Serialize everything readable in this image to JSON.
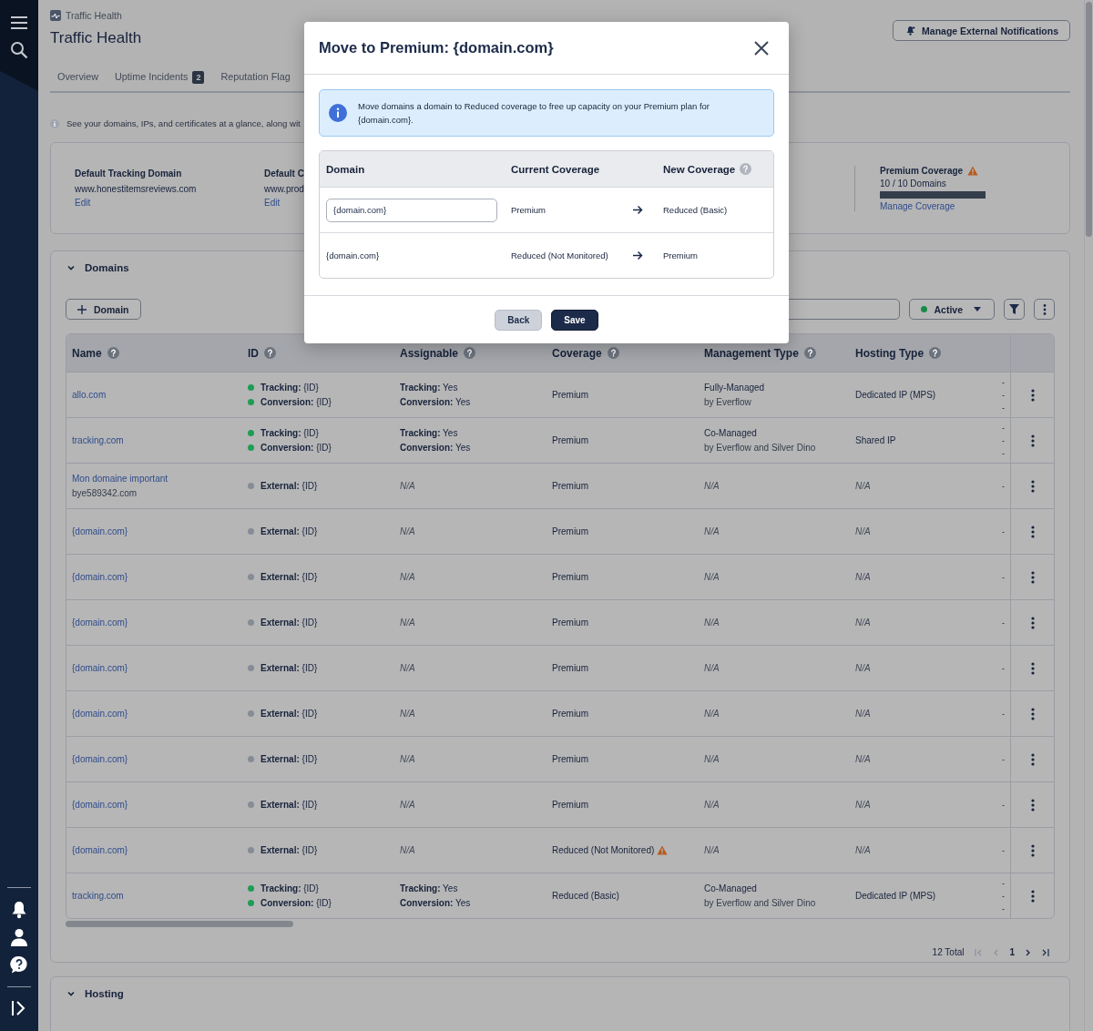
{
  "breadcrumb": "Traffic Health",
  "page_title": "Traffic Health",
  "notifications_button": "Manage External Notifications",
  "tabs": [
    {
      "label": "Overview",
      "selected": false
    },
    {
      "label": "Uptime Incidents",
      "badge": "2",
      "selected": false
    },
    {
      "label": "Reputation Flag",
      "selected": false
    }
  ],
  "info_text": "See your domains, IPs, and certificates at a glance, along wit",
  "defaults": [
    {
      "title": "Default Tracking Domain",
      "value": "www.honestitemsreviews.com",
      "link": "Edit"
    },
    {
      "title": "Default C",
      "value": "www.prod",
      "link": "Edit"
    }
  ],
  "premium_coverage": {
    "title": "Premium Coverage",
    "warning": true,
    "count": "10 / 10 Domains",
    "level": 1,
    "link": "Manage Coverage"
  },
  "domains": {
    "title": "Domains",
    "expanded": true,
    "add_button": "Domain",
    "status_filter": {
      "label": "Active",
      "color": "#178a48"
    },
    "table": {
      "columns": [
        {
          "label": "Name",
          "help": true
        },
        {
          "label": "ID",
          "help": true
        },
        {
          "label": "Assignable",
          "help": true
        },
        {
          "label": "Coverage",
          "help": true
        },
        {
          "label": "Management Type",
          "help": true
        },
        {
          "label": "Hosting Type",
          "help": true
        }
      ],
      "rows": [
        {
          "name": "allo.com",
          "ids": [
            {
              "label": "Tracking:",
              "value": "{ID}",
              "color": "#1f9d55"
            },
            {
              "label": "Conversion:",
              "value": "{ID}",
              "color": "#1f9d55"
            }
          ],
          "assignable": [
            {
              "label": "Tracking:",
              "value": "Yes"
            },
            {
              "label": "Conversion:",
              "value": "Yes"
            }
          ],
          "coverage": "Premium",
          "coverage_warning": false,
          "management": {
            "title": "Fully-Managed",
            "by": "by Everflow"
          },
          "hosting": "Dedicated IP (MPS)",
          "column_7": [
            "-",
            "-",
            "-"
          ]
        },
        {
          "name": "tracking.com",
          "ids": [
            {
              "label": "Tracking:",
              "value": "{ID}",
              "color": "#1f9d55"
            },
            {
              "label": "Conversion:",
              "value": "{ID}",
              "color": "#1f9d55"
            }
          ],
          "assignable": [
            {
              "label": "Tracking:",
              "value": "Yes"
            },
            {
              "label": "Conversion:",
              "value": "Yes"
            }
          ],
          "coverage": "Premium",
          "coverage_warning": false,
          "management": {
            "title": "Co-Managed",
            "by": "by Everflow and Silver Dino"
          },
          "hosting": "Shared IP",
          "column_7": [
            "-",
            "-",
            "-"
          ]
        },
        {
          "name": "Mon domaine important",
          "name_sub": "bye589342.com",
          "ids": [
            {
              "label": "External:",
              "value": "{ID}",
              "color": "#858c96"
            }
          ],
          "assignable": "N/A",
          "coverage": "Premium",
          "coverage_warning": false,
          "management": "N/A",
          "hosting": "N/A",
          "column_7": [
            "-"
          ]
        },
        {
          "name": "{domain.com}",
          "ids": [
            {
              "label": "External:",
              "value": "{ID}",
              "color": "#858c96"
            }
          ],
          "assignable": "N/A",
          "coverage": "Premium",
          "coverage_warning": false,
          "management": "N/A",
          "hosting": "N/A",
          "column_7": [
            "-"
          ]
        },
        {
          "name": "{domain.com}",
          "ids": [
            {
              "label": "External:",
              "value": "{ID}",
              "color": "#858c96"
            }
          ],
          "assignable": "N/A",
          "coverage": "Premium",
          "coverage_warning": false,
          "management": "N/A",
          "hosting": "N/A",
          "column_7": [
            "-"
          ]
        },
        {
          "name": "{domain.com}",
          "ids": [
            {
              "label": "External:",
              "value": "{ID}",
              "color": "#858c96"
            }
          ],
          "assignable": "N/A",
          "coverage": "Premium",
          "coverage_warning": false,
          "management": "N/A",
          "hosting": "N/A",
          "column_7": [
            "-"
          ]
        },
        {
          "name": "{domain.com}",
          "ids": [
            {
              "label": "External:",
              "value": "{ID}",
              "color": "#858c96"
            }
          ],
          "assignable": "N/A",
          "coverage": "Premium",
          "coverage_warning": false,
          "management": "N/A",
          "hosting": "N/A",
          "column_7": [
            "-"
          ]
        },
        {
          "name": "{domain.com}",
          "ids": [
            {
              "label": "External:",
              "value": "{ID}",
              "color": "#858c96"
            }
          ],
          "assignable": "N/A",
          "coverage": "Premium",
          "coverage_warning": false,
          "management": "N/A",
          "hosting": "N/A",
          "column_7": [
            "-"
          ]
        },
        {
          "name": "{domain.com}",
          "ids": [
            {
              "label": "External:",
              "value": "{ID}",
              "color": "#858c96"
            }
          ],
          "assignable": "N/A",
          "coverage": "Premium",
          "coverage_warning": false,
          "management": "N/A",
          "hosting": "N/A",
          "column_7": [
            "-"
          ]
        },
        {
          "name": "{domain.com}",
          "ids": [
            {
              "label": "External:",
              "value": "{ID}",
              "color": "#858c96"
            }
          ],
          "assignable": "N/A",
          "coverage": "Premium",
          "coverage_warning": false,
          "management": "N/A",
          "hosting": "N/A",
          "column_7": [
            "-"
          ]
        },
        {
          "name": "{domain.com}",
          "ids": [
            {
              "label": "External:",
              "value": "{ID}",
              "color": "#858c96"
            }
          ],
          "assignable": "N/A",
          "coverage": "Reduced (Not Monitored)",
          "coverage_warning": true,
          "management": "N/A",
          "hosting": "N/A",
          "column_7": [
            "-"
          ]
        },
        {
          "name": "tracking.com",
          "ids": [
            {
              "label": "Tracking:",
              "value": "{ID}",
              "color": "#1f9d55"
            },
            {
              "label": "Conversion:",
              "value": "{ID}",
              "color": "#1f9d55"
            }
          ],
          "assignable": [
            {
              "label": "Tracking:",
              "value": "Yes"
            },
            {
              "label": "Conversion:",
              "value": "Yes"
            }
          ],
          "coverage": "Reduced (Basic)",
          "coverage_warning": false,
          "management": {
            "title": "Co-Managed",
            "by": "by Everflow and Silver Dino"
          },
          "hosting": "Dedicated IP (MPS)",
          "column_7": [
            "-",
            "-",
            "-"
          ]
        }
      ]
    },
    "pagination": {
      "total": "12 Total",
      "page": "1"
    }
  },
  "hosting": {
    "title": "Hosting",
    "expanded": true
  },
  "modal": {
    "title": "Move to Premium: {domain.com}",
    "alert": "Move domains a domain to Reduced coverage to free up capacity on your Premium plan for {domain.com}.",
    "columns": [
      {
        "label": "Domain",
        "help": false
      },
      {
        "label": "Current Coverage",
        "help": false
      },
      {
        "label": "New Coverage",
        "help": true
      }
    ],
    "rows": [
      {
        "kind": "input",
        "domain": "{domain.com}",
        "current": "Premium",
        "new": "Reduced (Basic)"
      },
      {
        "kind": "text",
        "domain": "{domain.com}",
        "current": "Reduced (Not Monitored)",
        "new": "Premium"
      }
    ],
    "buttons": [
      {
        "label": "Back",
        "kind": "secondary"
      },
      {
        "label": "Save",
        "kind": "primary"
      }
    ]
  }
}
